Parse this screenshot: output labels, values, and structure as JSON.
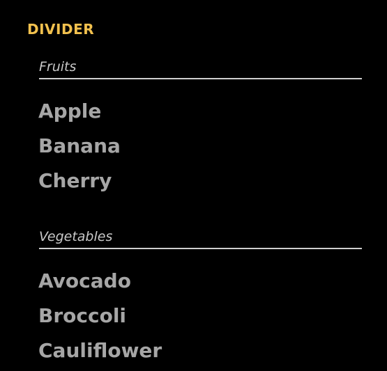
{
  "title": "DIVIDER",
  "groups": [
    {
      "header": "Fruits",
      "items": [
        "Apple",
        "Banana",
        "Cherry"
      ]
    },
    {
      "header": "Vegetables",
      "items": [
        "Avocado",
        "Broccoli",
        "Cauliflower"
      ]
    }
  ],
  "colors": {
    "title": "#f2c14e",
    "background": "#000000",
    "item_text": "#a6a6a6",
    "divider_line": "#cfcfcf"
  }
}
